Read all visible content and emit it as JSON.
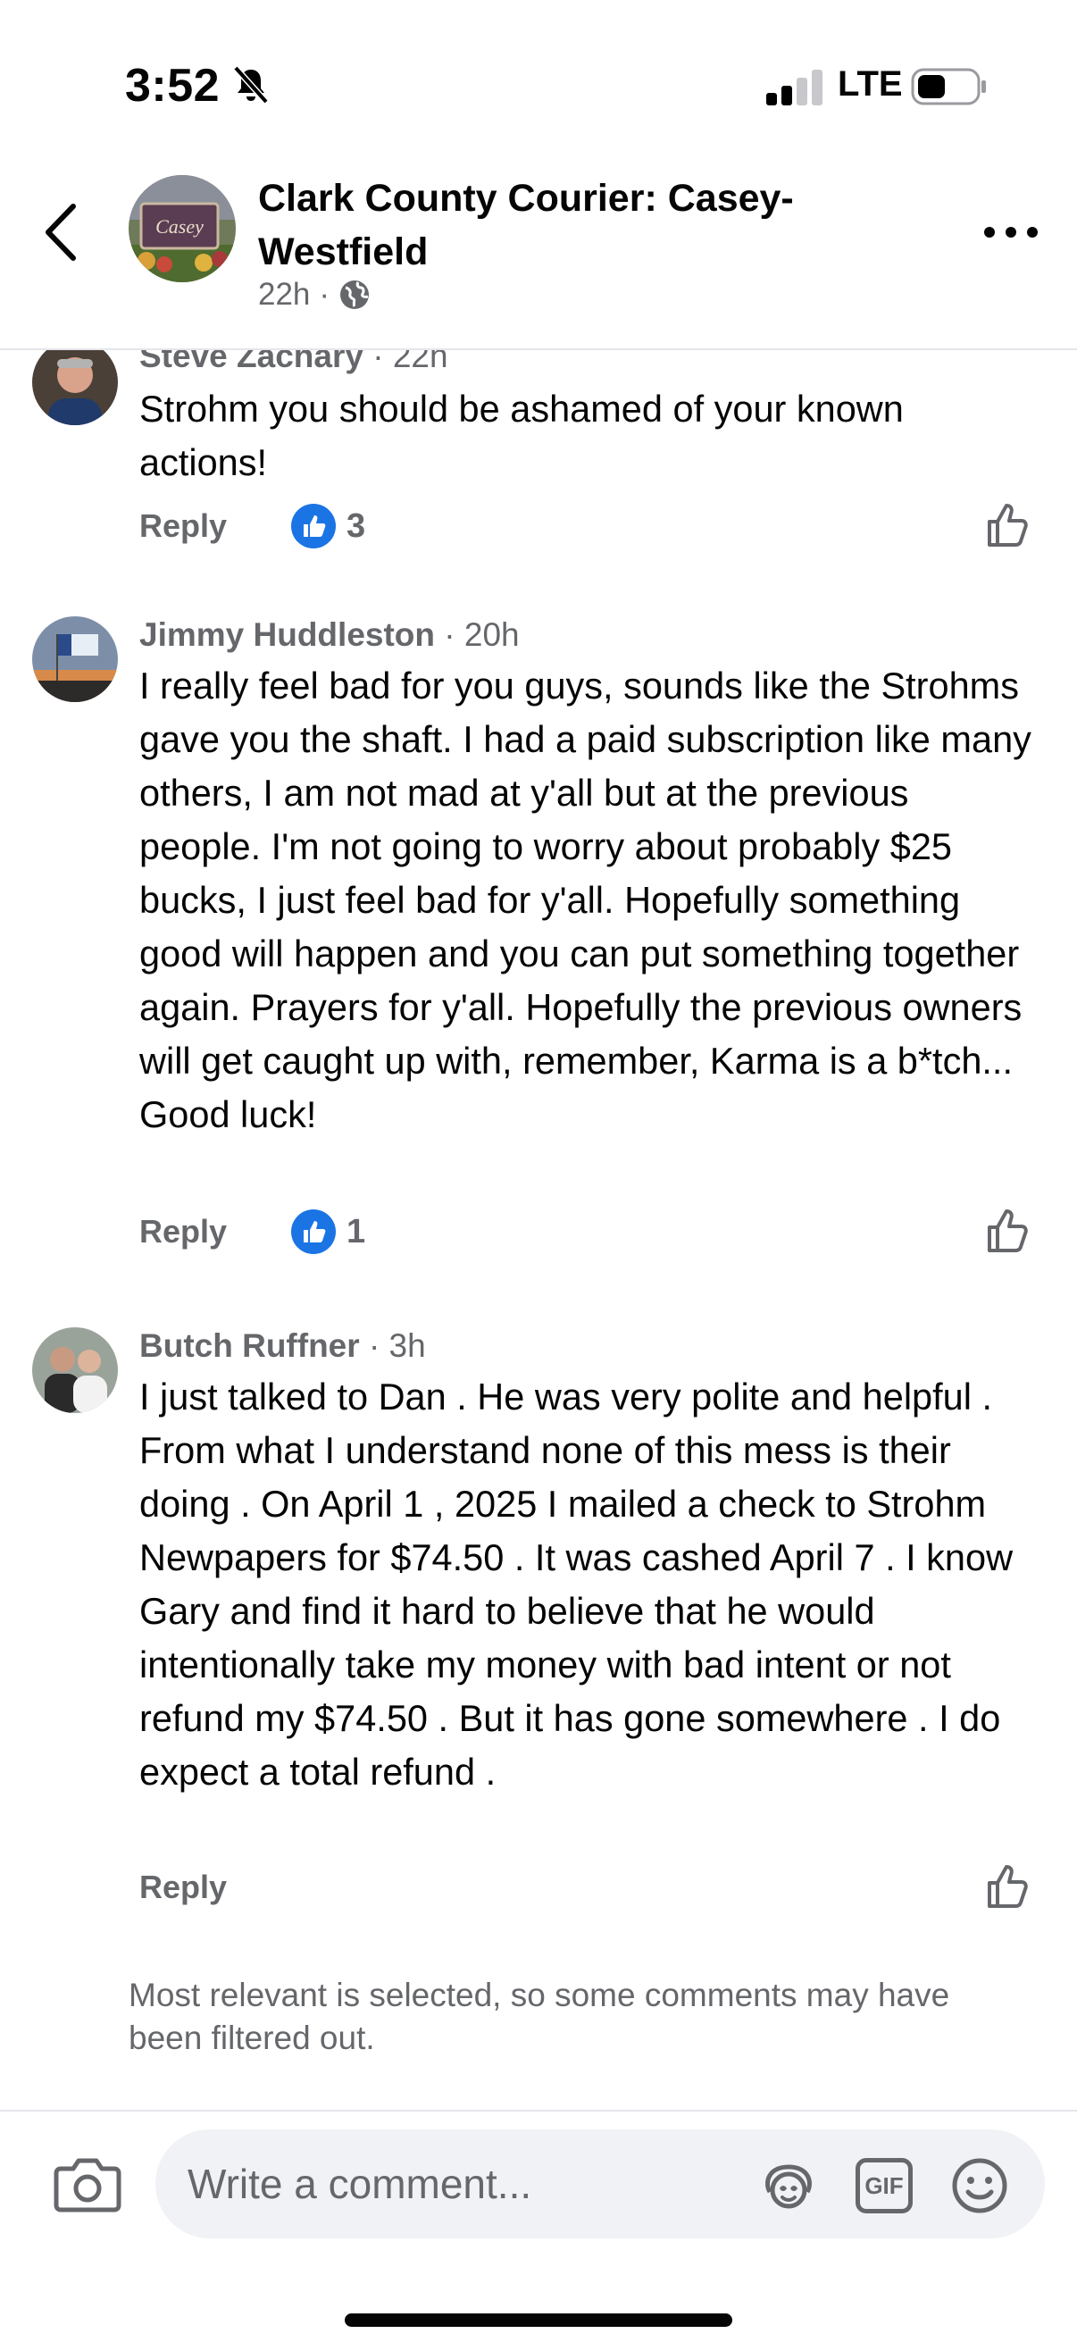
{
  "status_bar": {
    "time": "3:52",
    "network": "LTE"
  },
  "header": {
    "title": "Clark County Courier: Casey-Westfield",
    "time": "22h",
    "separator": "·",
    "avatar_label": "Casey"
  },
  "comments": [
    {
      "author": "Steve Zachary",
      "time": "· 22h",
      "text": "Strohm you should be ashamed of your known actions!",
      "reply_label": "Reply",
      "reactions": "3"
    },
    {
      "author": "Jimmy Huddleston",
      "time": "· 20h",
      "text": "I really feel bad for you guys, sounds like the Strohms gave you the shaft. I had a paid subscription like many others, I am not mad at y'all but at the previous people. I'm not going to worry about probably $25 bucks, I  just feel bad for y'all. Hopefully something good will happen and you can put something together again. Prayers for y'all. Hopefully the previous owners will get caught up with, remember, Karma is  a b*tch... Good luck!",
      "reply_label": "Reply",
      "reactions": "1"
    },
    {
      "author": "Butch Ruffner",
      "time": "· 3h",
      "text": "I just talked to Dan . He was very polite and helpful . From what I understand none of this mess is their doing . On April 1 , 2025 I mailed a check to Strohm Newpapers for $74.50 . It was cashed April 7 . I know Gary and find it hard to believe that he would intentionally take my money with bad intent or not refund my $74.50 . But it has gone somewhere . I do expect a total refund .",
      "reply_label": "Reply",
      "reactions": ""
    }
  ],
  "filter_note": "Most relevant is selected, so some comments may have been filtered out.",
  "composer": {
    "placeholder": "Write a comment...",
    "gif_label": "GIF"
  },
  "icons": {
    "back": "chevron-left-icon",
    "more": "more-horizontal-icon",
    "globe": "globe-icon",
    "like_badge": "thumbs-up-icon",
    "camera": "camera-icon",
    "avatar_sticker": "avatar-sticker-icon",
    "gif": "gif-icon",
    "emoji": "emoji-icon"
  },
  "colors": {
    "accent": "#1b74e4",
    "secondary_text": "#65676b",
    "input_bg": "#f0f2f5"
  }
}
